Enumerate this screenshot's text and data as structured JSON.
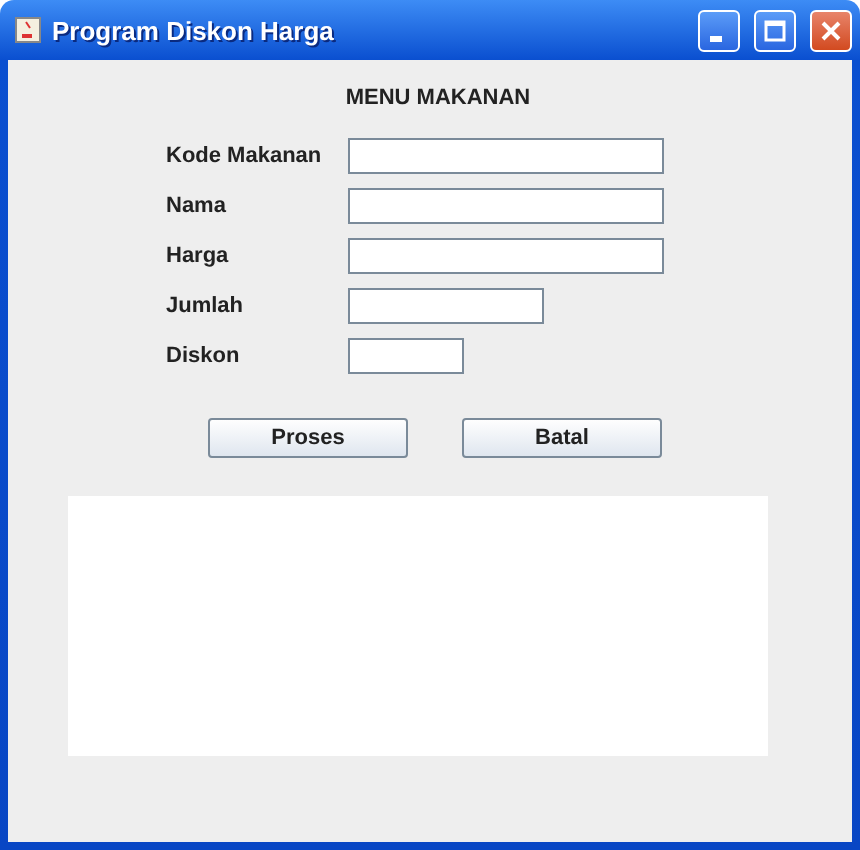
{
  "window": {
    "title": "Program Diskon Harga"
  },
  "heading": "MENU MAKANAN",
  "fields": [
    {
      "label": "Kode Makanan",
      "kind": "long"
    },
    {
      "label": "Nama",
      "kind": "long"
    },
    {
      "label": "Harga",
      "kind": "long"
    },
    {
      "label": "Jumlah",
      "kind": "medium"
    },
    {
      "label": "Diskon",
      "kind": "short"
    }
  ],
  "buttons": [
    "Proses",
    "Batal"
  ],
  "output": {
    "kind": "text-area"
  }
}
